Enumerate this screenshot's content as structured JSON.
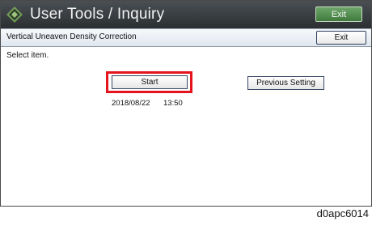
{
  "header": {
    "title": "User Tools / Inquiry",
    "exit_label": "Exit",
    "icon": "ricoh-diamond-icon"
  },
  "page": {
    "title": "Vertical Uneaven Density Correction",
    "exit_label": "Exit",
    "instruction": "Select item."
  },
  "actions": {
    "start_label": "Start",
    "previous_label": "Previous Setting",
    "last_date": "2018/08/22",
    "last_time": "13:50"
  },
  "figure_code": "d0apc6014",
  "colors": {
    "header_bg": "#2b2f32",
    "header_exit_bg": "#4f8c4b",
    "highlight": "#e3141b",
    "button_border": "#3b4a66"
  }
}
